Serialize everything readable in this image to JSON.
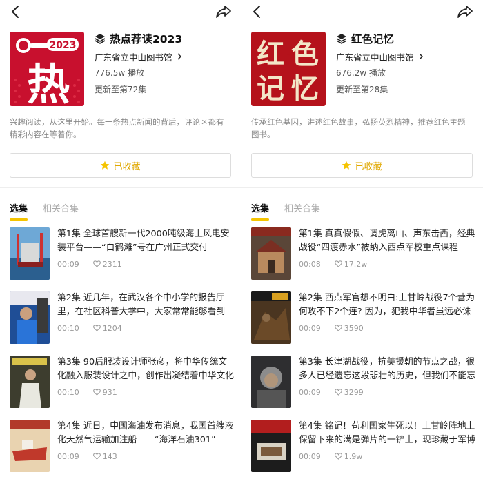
{
  "panels": [
    {
      "title": "热点荐读2023",
      "library": "广东省立中山图书馆",
      "plays": "776.5w 播放",
      "update": "更新至第72集",
      "description": "兴趣阅读，从这里开始。每一条热点新闻的背后，评论区都有精彩内容在等着你。",
      "fav_label": "已收藏",
      "cover_text": "热",
      "cover_badge": "2023",
      "tabs": [
        "选集",
        "相关合集"
      ],
      "episodes": [
        {
          "title": "第1集   全球首艘新一代2000吨级海上风电安装平台——“白鹤滩”号在广州正式交付",
          "duration": "00:09",
          "likes": "2311"
        },
        {
          "title": "第2集   近几年，在武汉各个中小学的报告厅里，在社区科普大学中，大家常常能够看到",
          "duration": "00:10",
          "likes": "1204"
        },
        {
          "title": "第3集   90后服装设计师张彦，将中华传统文化融入服装设计之中，创作出凝结着中华文化",
          "duration": "00:10",
          "likes": "931"
        },
        {
          "title": "第4集   近日，中国海油发布消息，我国首艘液化天然气运输加注船——“海洋石油301”",
          "duration": "00:09",
          "likes": "143"
        }
      ]
    },
    {
      "title": "红色记忆",
      "library": "广东省立中山图书馆",
      "plays": "676.2w 播放",
      "update": "更新至第28集",
      "description": "传承红色基因，讲述红色故事，弘扬英烈精神，推荐红色主题图书。",
      "fav_label": "已收藏",
      "cover_text": "红色记忆",
      "tabs": [
        "选集",
        "相关合集"
      ],
      "episodes": [
        {
          "title": "第1集   真真假假、调虎离山、声东击西，经典战役“四渡赤水”被纳入西点军校重点课程",
          "duration": "00:08",
          "likes": "17.2w"
        },
        {
          "title": "第2集   西点军官想不明白:上甘岭战役7个营为何攻不下2个连? 因为，犯我中华者虽远必诛",
          "duration": "00:09",
          "likes": "3590"
        },
        {
          "title": "第3集   长津湖战役，抗美援朝的节点之战，很多人已经遗忘这段悲壮的历史，但我们不能忘",
          "duration": "00:09",
          "likes": "3299"
        },
        {
          "title": "第4集   铭记！苟利国家生死以！上甘岭阵地上保留下来的满是弹片的一铲土，现珍藏于军博",
          "duration": "00:09",
          "likes": "1.9w"
        }
      ]
    }
  ],
  "colors": {
    "accent": "#f5c400",
    "fav_text": "#e0a800",
    "cover_red": "#c8102e",
    "cover_red2": "#b5121b"
  },
  "icons": [
    "back-icon",
    "share-icon",
    "stack-icon",
    "chevron-right-icon",
    "star-icon",
    "heart-icon"
  ]
}
